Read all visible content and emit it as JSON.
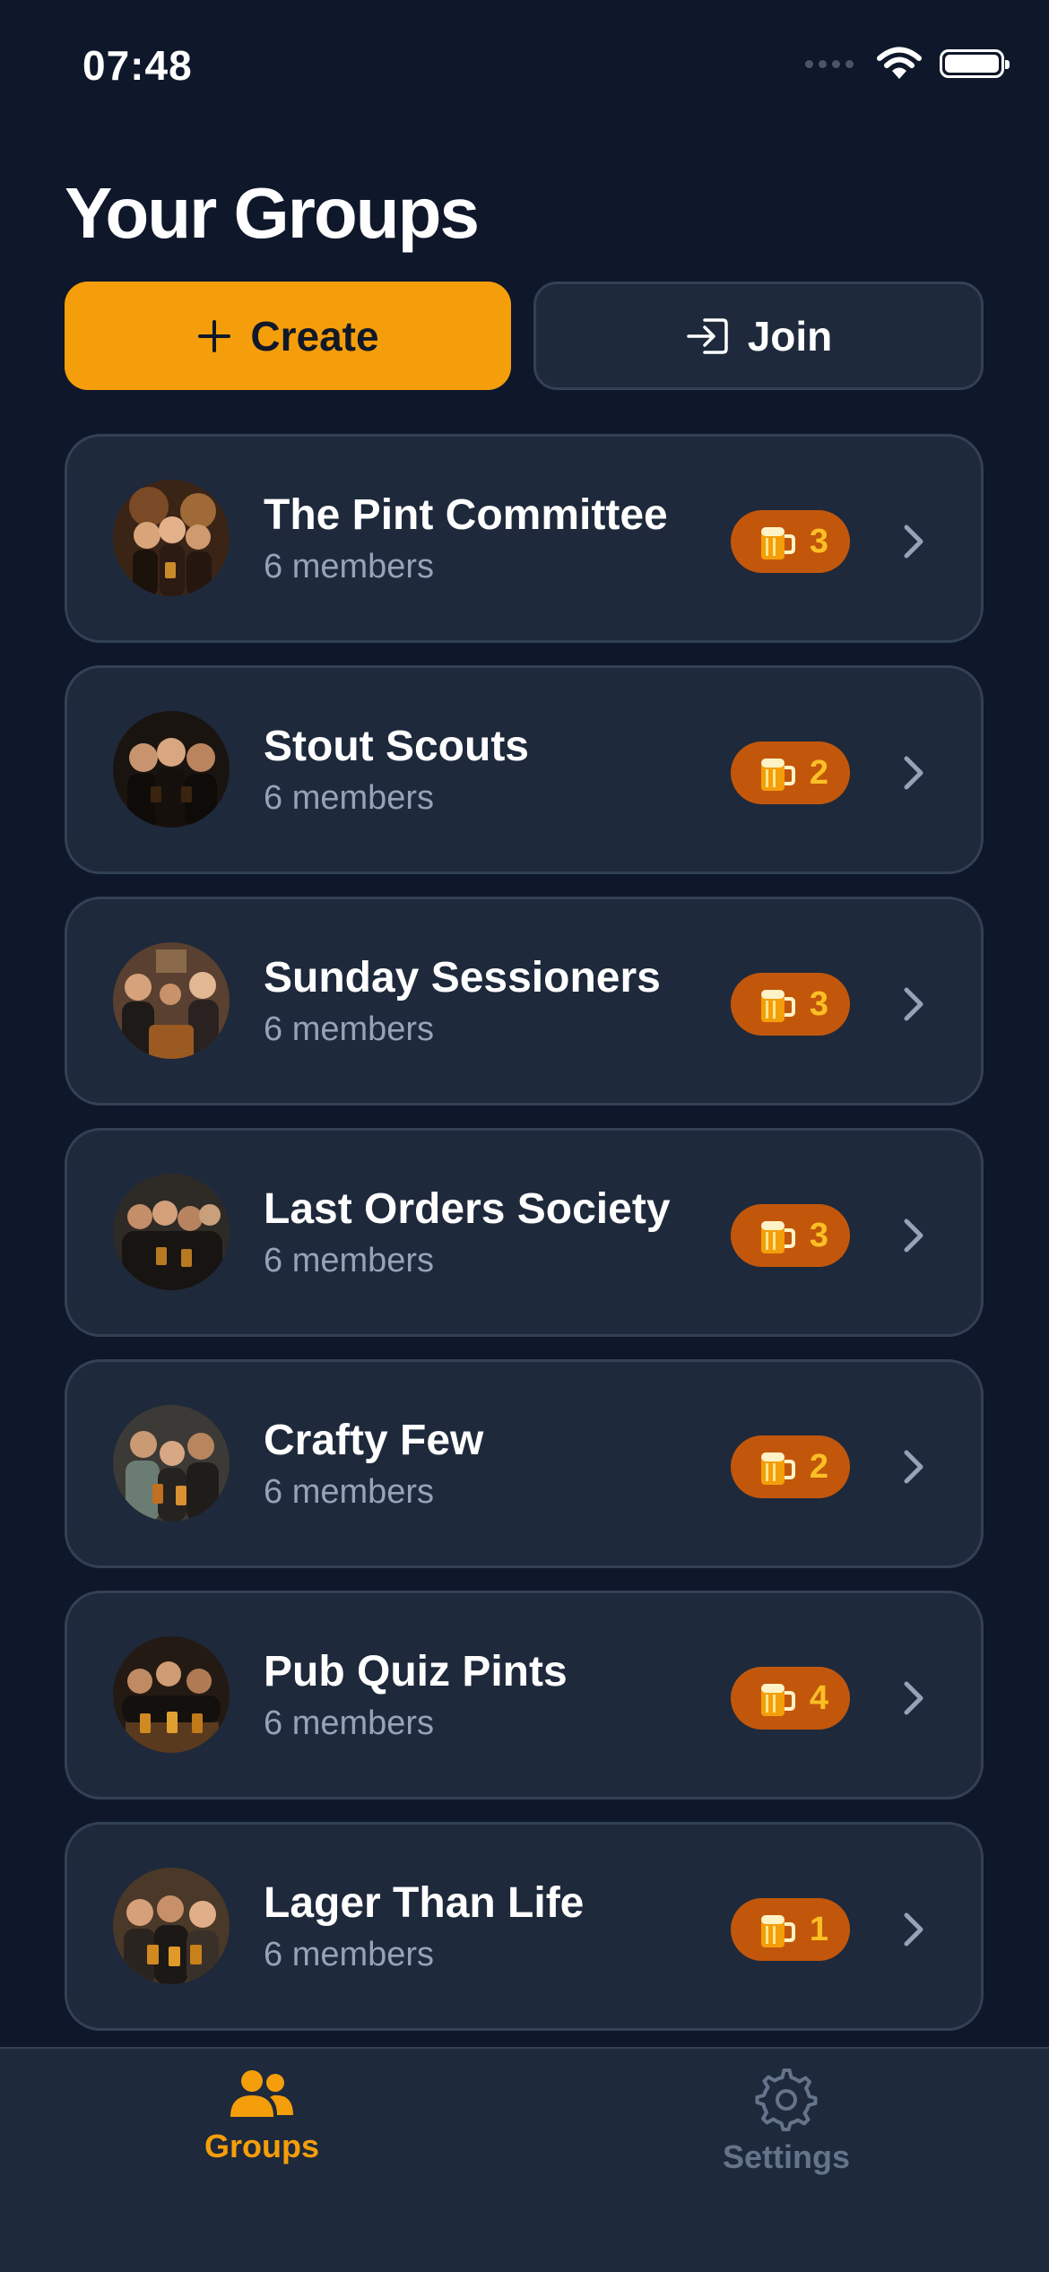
{
  "status_bar": {
    "time": "07:48"
  },
  "header": {
    "title": "Your Groups"
  },
  "actions": {
    "create_label": "Create",
    "join_label": "Join"
  },
  "groups": [
    {
      "name": "The Pint Committee",
      "members": "6 members",
      "count": "3"
    },
    {
      "name": "Stout Scouts",
      "members": "6 members",
      "count": "2"
    },
    {
      "name": "Sunday Sessioners",
      "members": "6 members",
      "count": "3"
    },
    {
      "name": "Last Orders Society",
      "members": "6 members",
      "count": "3"
    },
    {
      "name": "Crafty Few",
      "members": "6 members",
      "count": "2"
    },
    {
      "name": "Pub Quiz Pints",
      "members": "6 members",
      "count": "4"
    },
    {
      "name": "Lager Than Life",
      "members": "6 members",
      "count": "1"
    }
  ],
  "tab_bar": {
    "groups_label": "Groups",
    "settings_label": "Settings"
  },
  "colors": {
    "accent": "#f59e0b",
    "background": "#0f172a",
    "card": "#1e293b",
    "badge": "#c2570c"
  },
  "icons": [
    "plus-icon",
    "login-icon",
    "beer-mug-icon",
    "chevron-right-icon",
    "users-icon",
    "gear-icon",
    "wifi-icon",
    "battery-icon"
  ]
}
